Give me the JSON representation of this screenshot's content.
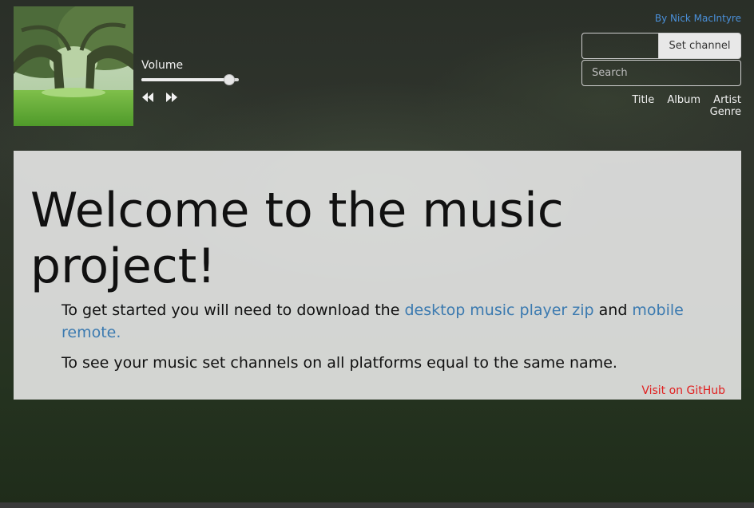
{
  "player": {
    "volume_label": "Volume",
    "volume_level": 0.9,
    "prev_icon": "rewind-icon",
    "next_icon": "fast-forward-icon"
  },
  "header": {
    "author_link": "By Nick MacIntyre"
  },
  "channel": {
    "value": "",
    "button_label": "Set channel"
  },
  "search": {
    "placeholder": "Search",
    "value": ""
  },
  "sort": {
    "title": "Title",
    "album": "Album",
    "artist": "Artist",
    "genre": "Genre"
  },
  "welcome": {
    "title": "Welcome to the music project!",
    "intro_text": "To get started you will need to download the ",
    "desktop_link": "desktop music player zip",
    "and_text": " and ",
    "mobile_link": "mobile remote.",
    "channels_text": "To see your music set channels on all platforms equal to the same name.",
    "github_link": "Visit on GitHub"
  },
  "colors": {
    "link": "#3b7ab0",
    "author_link": "#4a90d9",
    "github_link": "#e02020"
  }
}
